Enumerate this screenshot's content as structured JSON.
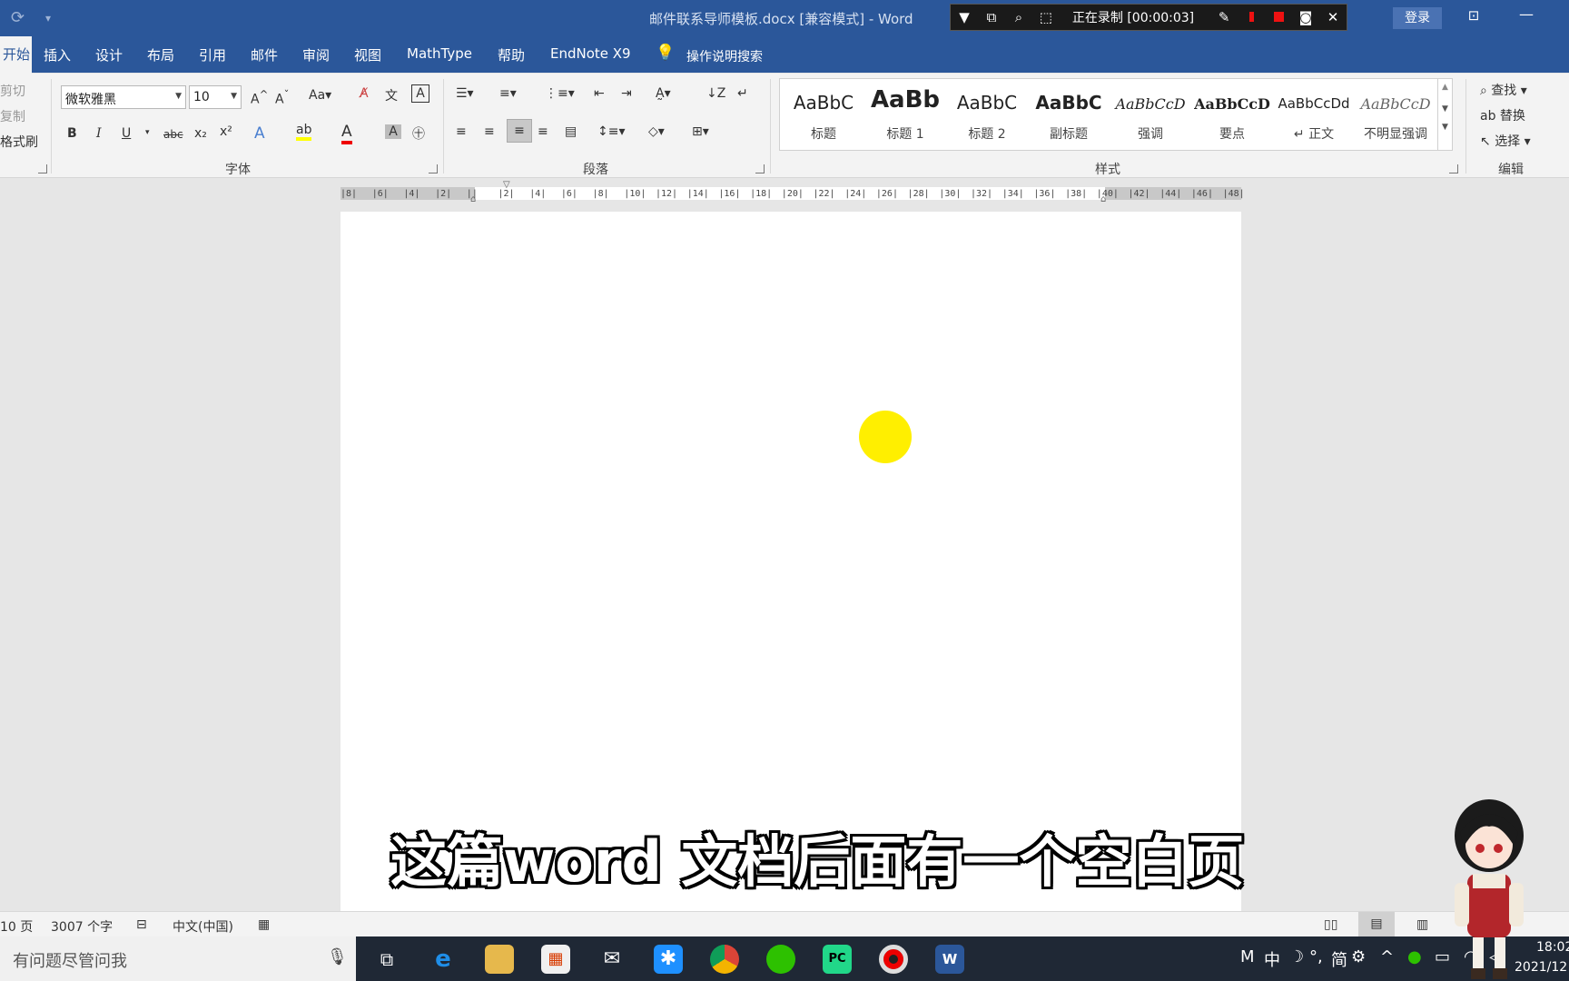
{
  "titlebar": {
    "doc_title": "邮件联系导师模板.docx [兼容模式]  -  Word",
    "recording": "正在录制 [00:00:03]",
    "login": "登录"
  },
  "tabs": {
    "home": "开始",
    "insert": "插入",
    "design": "设计",
    "layout": "布局",
    "references": "引用",
    "mailings": "邮件",
    "review": "审阅",
    "view": "视图",
    "mathtype": "MathType",
    "help": "帮助",
    "endnote": "EndNote X9",
    "tellme": "操作说明搜索"
  },
  "clipboard": {
    "cut": "剪切",
    "copy": "复制",
    "painter": "格式刷"
  },
  "font": {
    "name": "微软雅黑",
    "size": "10",
    "group_label": "字体"
  },
  "paragraph": {
    "group_label": "段落"
  },
  "styles": {
    "group_label": "样式",
    "items": [
      {
        "preview": "AaBbC",
        "name": "标题"
      },
      {
        "preview": "AaBb",
        "name": "标题 1"
      },
      {
        "preview": "AaBbC",
        "name": "标题 2"
      },
      {
        "preview": "AaBbC",
        "name": "副标题"
      },
      {
        "preview": "AaBbCcD",
        "name": "强调"
      },
      {
        "preview": "AaBbCcD",
        "name": "要点"
      },
      {
        "preview": "AaBbCcDd",
        "name": "↵ 正文"
      },
      {
        "preview": "AaBbCcD",
        "name": "不明显强调"
      }
    ]
  },
  "editing": {
    "find": "查找",
    "replace": "替换",
    "select": "选择",
    "group_label": "编辑"
  },
  "ruler": {
    "ticks": [
      "8",
      "6",
      "4",
      "2",
      "",
      "2",
      "4",
      "6",
      "8",
      "10",
      "12",
      "14",
      "16",
      "18",
      "20",
      "22",
      "24",
      "26",
      "28",
      "30",
      "32",
      "34",
      "36",
      "38",
      "40",
      "42",
      "44",
      "46",
      "48"
    ]
  },
  "subtitle": "这篇word 文档后面有一个空白页",
  "statusbar": {
    "pages": "10 页",
    "words": "3007 个字",
    "language": "中文(中国)"
  },
  "taskbar": {
    "search": "有问题尽管问我",
    "time": "18:02",
    "date": "2021/12",
    "ime": "中",
    "ime2": "简"
  },
  "colors": {
    "word_blue": "#2b579a",
    "ribbon_bg": "#f3f3f3",
    "cursor_dot": "#ffef00",
    "record_red": "#e11"
  }
}
